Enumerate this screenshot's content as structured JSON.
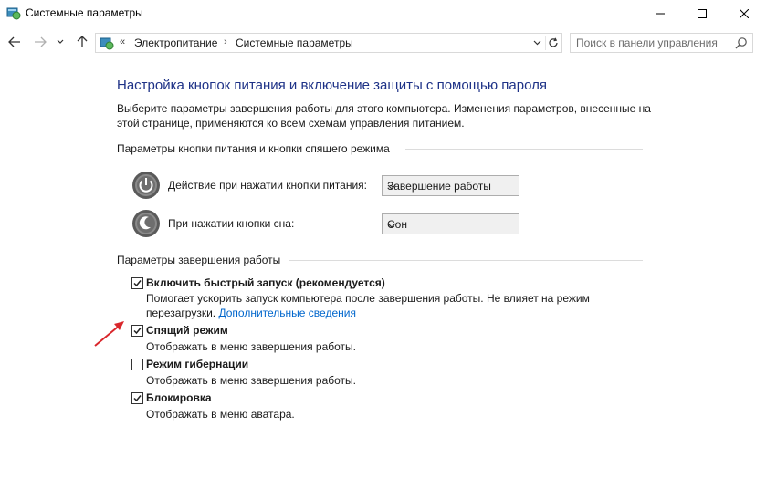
{
  "window": {
    "title": "Системные параметры"
  },
  "nav": {
    "chevron": "«",
    "breadcrumb": [
      "Электропитание",
      "Системные параметры"
    ],
    "separator": "›",
    "search_placeholder": "Поиск в панели управления"
  },
  "page": {
    "heading": "Настройка кнопок питания и включение защиты с помощью пароля",
    "description": "Выберите параметры завершения работы для этого компьютера. Изменения параметров, внесенные на этой странице, применяются ко всем схемам управления питанием."
  },
  "power_buttons": {
    "group_title": "Параметры кнопки питания и кнопки спящего режима",
    "rows": [
      {
        "label": "Действие при нажатии кнопки питания:",
        "value": "Завершение работы",
        "icon": "power-button-icon"
      },
      {
        "label": "При нажатии кнопки сна:",
        "value": "Сон",
        "icon": "sleep-button-icon"
      }
    ]
  },
  "shutdown": {
    "group_title": "Параметры завершения работы",
    "options": [
      {
        "label": "Включить быстрый запуск (рекомендуется)",
        "checked": true,
        "description": "Помогает ускорить запуск компьютера после завершения работы. Не влияет на режим перезагрузки.",
        "link": "Дополнительные сведения"
      },
      {
        "label": "Спящий режим",
        "checked": true,
        "description": "Отображать в меню завершения работы."
      },
      {
        "label": "Режим гибернации",
        "checked": false,
        "description": "Отображать в меню завершения работы."
      },
      {
        "label": "Блокировка",
        "checked": true,
        "description": "Отображать в меню аватара."
      }
    ]
  },
  "colors": {
    "heading": "#1e3287",
    "link": "#0066cc",
    "arrow": "#d9262b"
  }
}
